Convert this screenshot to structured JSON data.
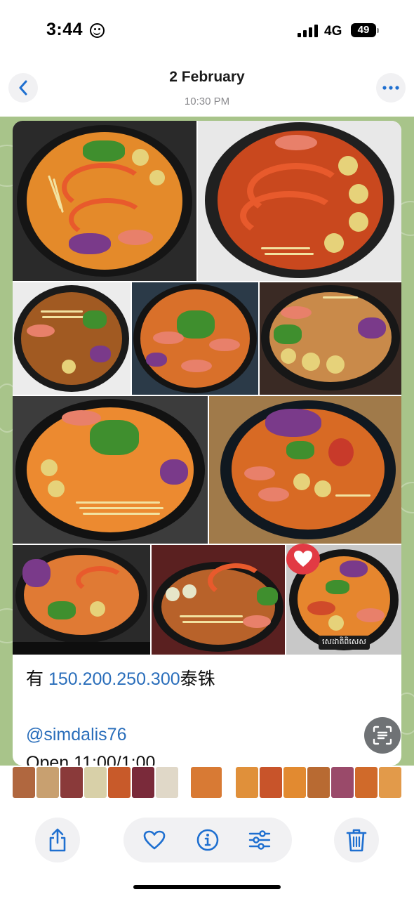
{
  "status_bar": {
    "time": "3:44",
    "network": "4G",
    "battery": "49",
    "icons": [
      "smiley-icon",
      "signal-icon",
      "battery-icon"
    ]
  },
  "header": {
    "title": "2 February",
    "subtitle": "10:30 PM",
    "icons": [
      "chevron-left-icon",
      "ellipsis-icon"
    ]
  },
  "message": {
    "line1_prefix": "有 ",
    "line1_link": "150.200.250.300",
    "line1_suffix": "泰铢",
    "handle": "@simdalis76",
    "open_hours": "Open 11:00/1:00",
    "photo_tag": "សេដាតិពិសេស"
  },
  "toolbar": {
    "icons": [
      "share-icon",
      "heart-icon",
      "info-icon",
      "sliders-icon",
      "trash-icon"
    ]
  },
  "colors": {
    "accent": "#1e6fd0",
    "chat_background": "#a8c48a",
    "link": "#2a6ebb",
    "heart_badge": "#e23a44",
    "button_background": "#f1f1f3"
  }
}
